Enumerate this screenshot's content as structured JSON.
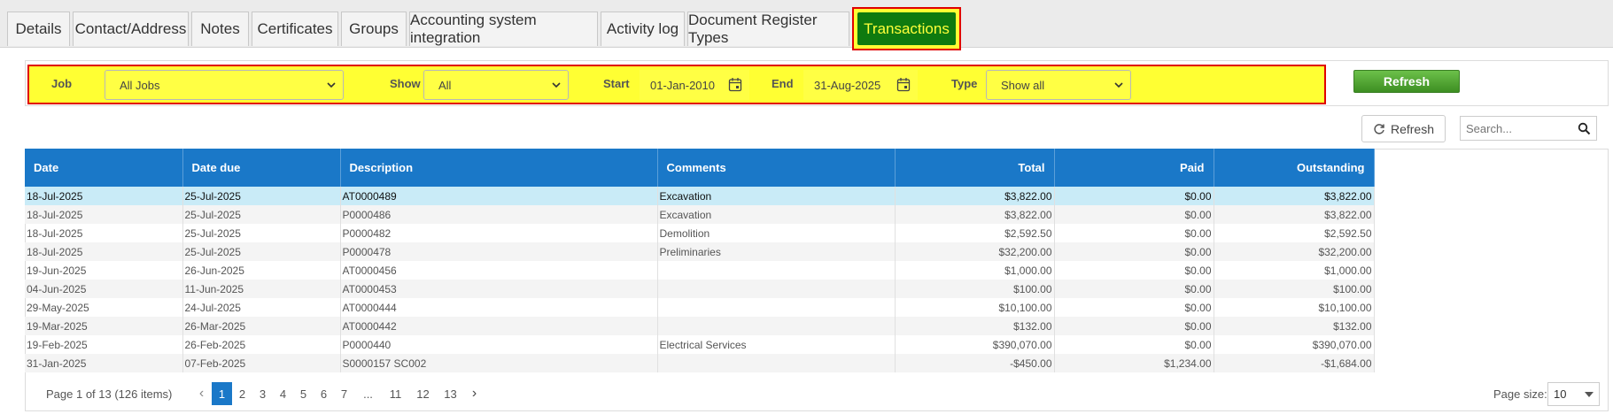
{
  "tabs": [
    {
      "label": "Details"
    },
    {
      "label": "Contact/Address"
    },
    {
      "label": "Notes"
    },
    {
      "label": "Certificates"
    },
    {
      "label": "Groups"
    },
    {
      "label": "Accounting system integration"
    },
    {
      "label": "Activity log"
    },
    {
      "label": "Document Register Types"
    },
    {
      "label": "Transactions"
    }
  ],
  "filters": {
    "job_label": "Job",
    "job_value": "All Jobs",
    "show_label": "Show",
    "show_value": "All",
    "start_label": "Start",
    "start_value": "01-Jan-2010",
    "end_label": "End",
    "end_value": "31-Aug-2025",
    "type_label": "Type",
    "type_value": "Show all",
    "refresh_label": "Refresh"
  },
  "toolbar": {
    "refresh_label": "Refresh",
    "search_placeholder": "Search..."
  },
  "grid": {
    "columns": [
      "Date",
      "Date due",
      "Description",
      "Comments",
      "Total",
      "Paid",
      "Outstanding"
    ],
    "rows": [
      [
        "18-Jul-2025",
        "25-Jul-2025",
        "AT0000489",
        "Excavation",
        "$3,822.00",
        "$0.00",
        "$3,822.00"
      ],
      [
        "18-Jul-2025",
        "25-Jul-2025",
        "P0000486",
        "Excavation",
        "$3,822.00",
        "$0.00",
        "$3,822.00"
      ],
      [
        "18-Jul-2025",
        "25-Jul-2025",
        "P0000482",
        "Demolition",
        "$2,592.50",
        "$0.00",
        "$2,592.50"
      ],
      [
        "18-Jul-2025",
        "25-Jul-2025",
        "P0000478",
        "Preliminaries",
        "$32,200.00",
        "$0.00",
        "$32,200.00"
      ],
      [
        "19-Jun-2025",
        "26-Jun-2025",
        "AT0000456",
        "",
        "$1,000.00",
        "$0.00",
        "$1,000.00"
      ],
      [
        "04-Jun-2025",
        "11-Jun-2025",
        "AT0000453",
        "",
        "$100.00",
        "$0.00",
        "$100.00"
      ],
      [
        "29-May-2025",
        "24-Jul-2025",
        "AT0000444",
        "",
        "$10,100.00",
        "$0.00",
        "$10,100.00"
      ],
      [
        "19-Mar-2025",
        "26-Mar-2025",
        "AT0000442",
        "",
        "$132.00",
        "$0.00",
        "$132.00"
      ],
      [
        "19-Feb-2025",
        "26-Feb-2025",
        "P0000440",
        "Electrical Services",
        "$390,070.00",
        "$0.00",
        "$390,070.00"
      ],
      [
        "31-Jan-2025",
        "07-Feb-2025",
        "S0000157 SC002",
        "",
        "-$450.00",
        "$1,234.00",
        "-$1,684.00"
      ]
    ]
  },
  "pager": {
    "info": "Page 1 of 13 (126 items)",
    "pages": [
      "1",
      "2",
      "3",
      "4",
      "5",
      "6",
      "7",
      "...",
      "11",
      "12",
      "13"
    ],
    "page_size_label": "Page size:",
    "page_size_value": "10"
  }
}
